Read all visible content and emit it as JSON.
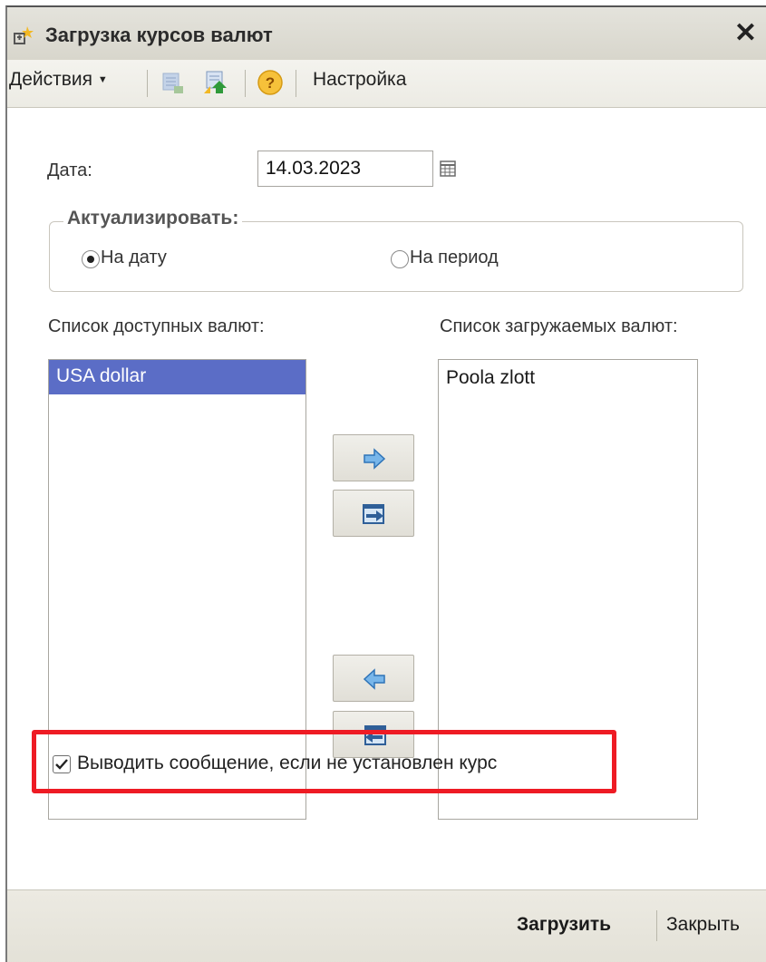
{
  "window": {
    "title": "Загрузка курсов валют",
    "close_icon": "close-icon"
  },
  "toolbar": {
    "actions_label": "Действия",
    "settings_label": "Настройка",
    "icons": [
      "list-icon",
      "download-icon",
      "help-icon"
    ]
  },
  "form": {
    "date_label": "Дата:",
    "date_value": "14.03.2023",
    "update_group_title": "Актуализировать:",
    "radio_on_date": "На дату",
    "radio_on_period": "На период",
    "radio_selected": "На дату"
  },
  "lists": {
    "available_title": "Список доступных валют:",
    "available_items": [
      "USA dollar"
    ],
    "available_selected": "USA dollar",
    "loaded_title": "Список загружаемых валют:",
    "loaded_items": [
      "Poola zlott"
    ]
  },
  "options": {
    "show_message_label": "Выводить сообщение, если не установлен курс",
    "show_message_checked": true
  },
  "footer": {
    "load_label": "Загрузить",
    "close_label": "Закрыть"
  },
  "colors": {
    "selection": "#5b6dc6",
    "highlight_frame": "#ee1b24",
    "arrow_blue": "#3f8fd8"
  }
}
